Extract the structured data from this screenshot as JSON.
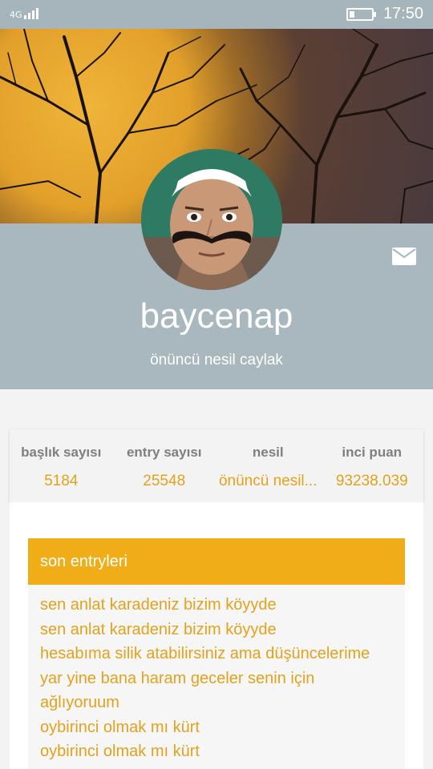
{
  "status_bar": {
    "network": "4G",
    "battery_level": 0.22,
    "time": "17:50"
  },
  "profile": {
    "username": "baycenap",
    "title": "önüncü nesil caylak",
    "cover_icon": "tree-sunset-cover",
    "avatar_icon": "user-avatar",
    "message_icon": "mail-icon"
  },
  "stats": [
    {
      "label": "başlık sayısı",
      "value": "5184"
    },
    {
      "label": "entry sayısı",
      "value": "25548"
    },
    {
      "label": "nesil",
      "value": "önüncü nesil..."
    },
    {
      "label": "inci puan",
      "value": "93238.039"
    }
  ],
  "entries": {
    "header": "son entryleri",
    "items": [
      "sen anlat karadeniz bizim köyyde",
      "sen anlat karadeniz bizim köyyde",
      "hesabıma silik atabilirsiniz ama düşüncelerime",
      "yar yine bana haram geceler senin için",
      "ağlıyoruum",
      "oybirinci olmak mı kürt",
      "oybirinci olmak mı kürt"
    ]
  },
  "colors": {
    "status_bar": "#a5b5bb",
    "band": "#a8b8be",
    "accent": "#f1ad18",
    "accent_text": "#e2a21c",
    "label_gray": "#7f7f7f"
  }
}
